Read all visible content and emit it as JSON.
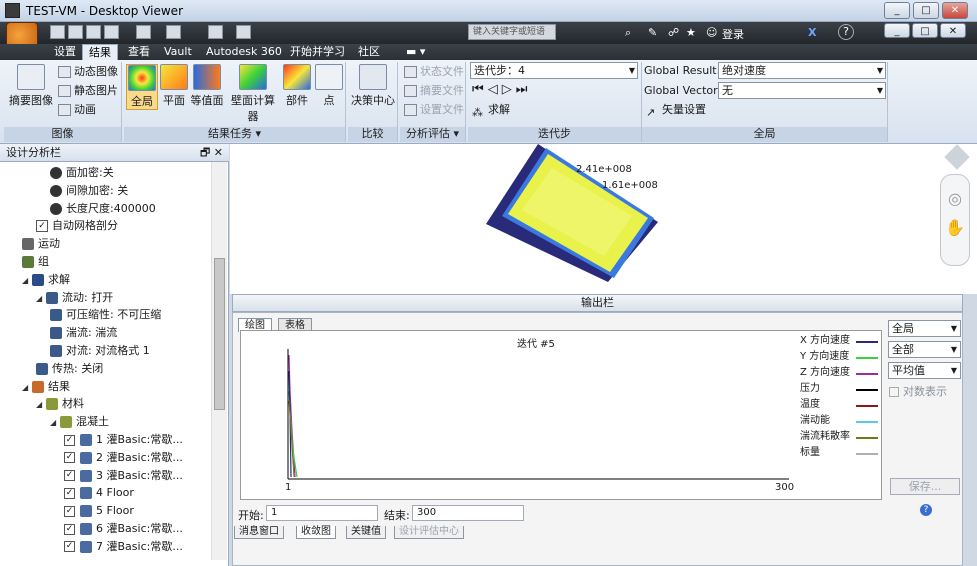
{
  "window": {
    "title": "TEST-VM - Desktop Viewer",
    "buttons": [
      "_",
      "□",
      "✕"
    ]
  },
  "qat": {
    "search_placeholder": "键入关键字或短语",
    "login": "登录",
    "help": "?"
  },
  "app_button": "CFD",
  "tabs": [
    "设置",
    "结果",
    "查看",
    "Vault",
    "Autodesk 360",
    "开始并学习",
    "社区"
  ],
  "ribbon": {
    "image_group": {
      "label": "图像",
      "big": "摘要图像",
      "small": [
        "动态图像",
        "静态图片",
        "动画"
      ]
    },
    "result_tasks": {
      "label": "结果任务",
      "buttons": [
        "全局",
        "平面",
        "等值面",
        "壁面计算器",
        "部件",
        "点"
      ]
    },
    "compare": {
      "label": "比较",
      "button": "决策中心"
    },
    "analysis": {
      "label": "分析评估",
      "items": [
        "状态文件",
        "摘要文件",
        "设置文件"
      ]
    },
    "iteration": {
      "label": "迭代步",
      "step": "迭代步：4",
      "solve": "求解"
    },
    "global": {
      "label": "全局",
      "result_label": "Global Result:",
      "result_value": "绝对速度",
      "vector_label": "Global Vector:",
      "vector_value": "无",
      "vector_settings": "矢量设置"
    }
  },
  "design_panel": {
    "title": "设计分析栏",
    "tree": [
      {
        "text": "面加密:关",
        "indent": 3,
        "icon": "info"
      },
      {
        "text": "间隙加密: 关",
        "indent": 3,
        "icon": "info"
      },
      {
        "text": "长度尺度:400000",
        "indent": 3,
        "icon": "info"
      },
      {
        "text": "自动网格剖分",
        "indent": 2,
        "icon": "check"
      },
      {
        "text": "运动",
        "indent": 1,
        "icon": "motion"
      },
      {
        "text": "组",
        "indent": 1,
        "icon": "group"
      },
      {
        "text": "求解",
        "indent": 1,
        "icon": "solve",
        "toggle": "◢"
      },
      {
        "text": "流动: 打开",
        "indent": 2,
        "icon": "arrow",
        "toggle": "◢"
      },
      {
        "text": "可压缩性: 不可压缩",
        "indent": 3,
        "icon": "arrow"
      },
      {
        "text": "湍流: 湍流",
        "indent": 3,
        "icon": "arrow"
      },
      {
        "text": "对流: 对流格式 1",
        "indent": 3,
        "icon": "arrow"
      },
      {
        "text": "传热: 关闭",
        "indent": 2,
        "icon": "arrow"
      },
      {
        "text": "结果",
        "indent": 1,
        "icon": "results",
        "toggle": "◢"
      },
      {
        "text": "材料",
        "indent": 2,
        "icon": "material",
        "toggle": "◢"
      },
      {
        "text": "混凝土",
        "indent": 3,
        "icon": "material",
        "toggle": "◢"
      },
      {
        "text": "1 灌Basic:常歇...",
        "indent": 4,
        "icon": "part",
        "check": true
      },
      {
        "text": "2 灌Basic:常歇...",
        "indent": 4,
        "icon": "part",
        "check": true
      },
      {
        "text": "3 灌Basic:常歇...",
        "indent": 4,
        "icon": "part",
        "check": true
      },
      {
        "text": "4 Floor",
        "indent": 4,
        "icon": "part",
        "check": true
      },
      {
        "text": "5 Floor",
        "indent": 4,
        "icon": "part",
        "check": true
      },
      {
        "text": "6 灌Basic:常歇...",
        "indent": 4,
        "icon": "part",
        "check": true
      },
      {
        "text": "7 灌Basic:常歇...",
        "indent": 4,
        "icon": "part",
        "check": true
      }
    ]
  },
  "viewport": {
    "legend_labels": [
      "2.41e+008",
      "1.61e+008"
    ]
  },
  "output": {
    "title": "输出栏",
    "tabs": [
      "绘图",
      "表格"
    ],
    "plot_title": "迭代 #5",
    "series": [
      {
        "name": "X 方向速度",
        "color": "#2a2a7a"
      },
      {
        "name": "Y 方向速度",
        "color": "#3ad13a"
      },
      {
        "name": "Z 方向速度",
        "color": "#a02aa0"
      },
      {
        "name": "压力",
        "color": "#000000"
      },
      {
        "name": "温度",
        "color": "#8b1a1a"
      },
      {
        "name": "湍动能",
        "color": "#5ec8e8"
      },
      {
        "name": "湍流耗散率",
        "color": "#6b7a1a"
      },
      {
        "name": "标量",
        "color": "#b0b0b0"
      }
    ],
    "x_min": "1",
    "x_max": "300",
    "right_combos": [
      "全局",
      "全部",
      "平均值"
    ],
    "log_display": "对数表示",
    "save": "保存...",
    "start_label": "开始:",
    "start_value": "1",
    "end_label": "结束:",
    "end_value": "300",
    "bottom_tabs": [
      "消息窗口",
      "收敛图",
      "关键值",
      "设计评估中心"
    ]
  }
}
